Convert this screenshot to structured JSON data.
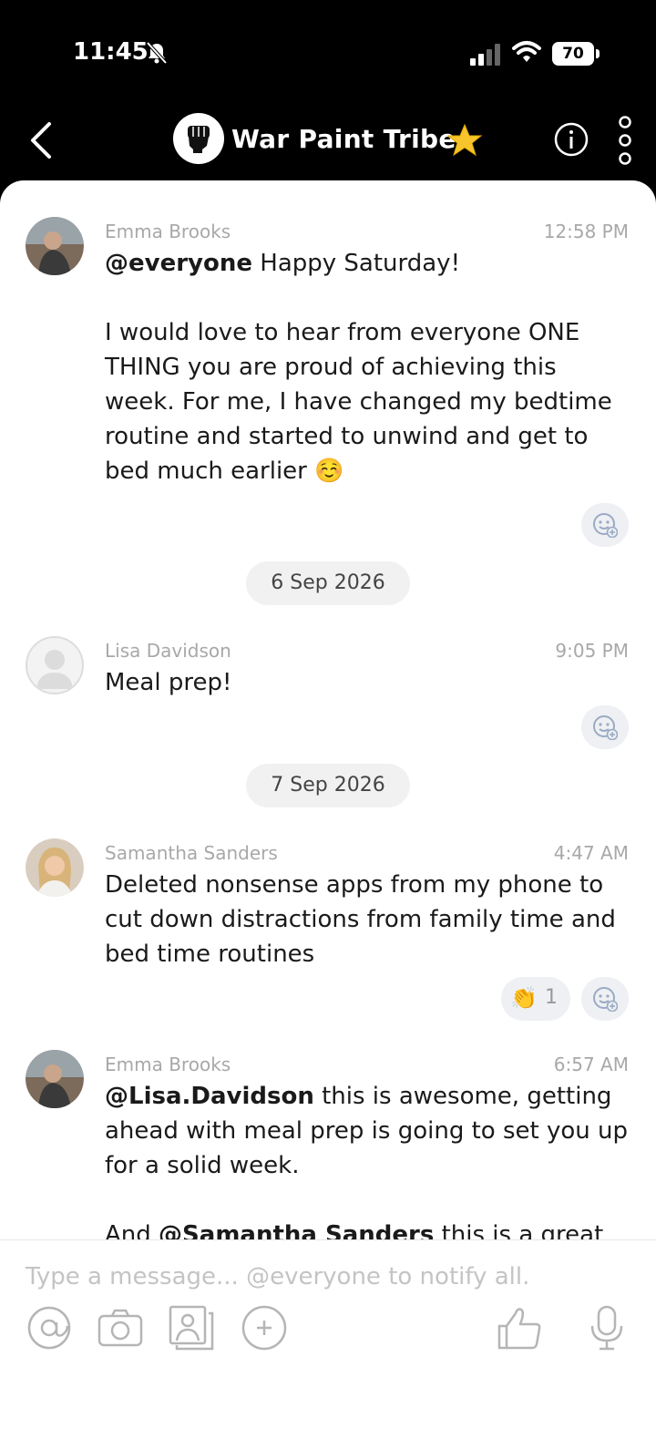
{
  "status_bar": {
    "time": "11:45",
    "battery": "70"
  },
  "header": {
    "title": "War Paint Tribe"
  },
  "messages": [
    {
      "sender": "Emma Brooks",
      "time": "12:58 PM",
      "mention": "@everyone",
      "text1": " Happy Saturday!",
      "text2": "I would love to hear from everyone ONE THING you are proud of achieving this week. For me, I have changed my bedtime routine and started to unwind and get to bed much earlier ☺️"
    },
    {
      "sender": "Lisa Davidson",
      "time": "9:05 PM",
      "text": "Meal prep!"
    },
    {
      "sender": "Samantha Sanders",
      "time": "4:47 AM",
      "text": "Deleted nonsense apps from my phone to cut down distractions from family time and bed time routines",
      "reaction_emoji": "👏",
      "reaction_count": "1"
    },
    {
      "sender": "Emma Brooks",
      "time": "6:57 AM",
      "mention": "@Lisa.Davidson",
      "text1": " this is awesome, getting ahead with meal prep is going to set you up for a solid week.",
      "text2_pre": "And ",
      "mention2": "@Samantha Sanders",
      "text2_post": " this is a great"
    }
  ],
  "dates": [
    "6 Sep 2026",
    "7 Sep 2026"
  ],
  "composer": {
    "placeholder": "Type a message... @everyone to notify all."
  }
}
